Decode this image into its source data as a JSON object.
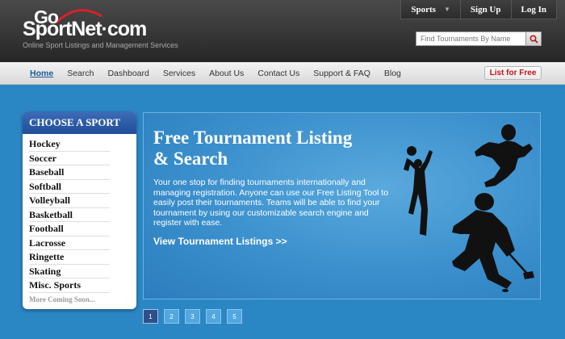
{
  "brand": {
    "logo_go": "Go",
    "logo_main": "SportNet·com",
    "tagline": "Online Sport Listings and Management Services"
  },
  "top_nav": {
    "sports_label": "Sports",
    "signup_label": "Sign Up",
    "login_label": "Log In"
  },
  "search": {
    "placeholder": "Find Tournaments By Name"
  },
  "nav": {
    "items": [
      "Home",
      "Search",
      "Dashboard",
      "Services",
      "About Us",
      "Contact Us",
      "Support & FAQ",
      "Blog"
    ],
    "active": "Home",
    "list_free_label": "List for Free"
  },
  "sidebar": {
    "title": "CHOOSE A SPORT",
    "sports": [
      "Hockey",
      "Soccer",
      "Baseball",
      "Softball",
      "Volleyball",
      "Basketball",
      "Football",
      "Lacrosse",
      "Ringette",
      "Skating",
      "Misc. Sports"
    ],
    "more_label": "More Coming Soon..."
  },
  "hero": {
    "title": "Free Tournament Listing & Search",
    "text": "Your one stop for finding tournaments internationally and managing registration. Anyone can use our Free Listing Tool to easily post their tournaments. Teams will be able to find your tournament by using our customizable search engine and register with ease.",
    "link": "View Tournament Listings >>"
  },
  "pager": {
    "pages": [
      "1",
      "2",
      "3",
      "4",
      "5"
    ],
    "active": "1"
  },
  "colors": {
    "accent_blue": "#2b86c4",
    "sidebar_head": "#1f4c97",
    "list_free_red": "#c1121a"
  }
}
